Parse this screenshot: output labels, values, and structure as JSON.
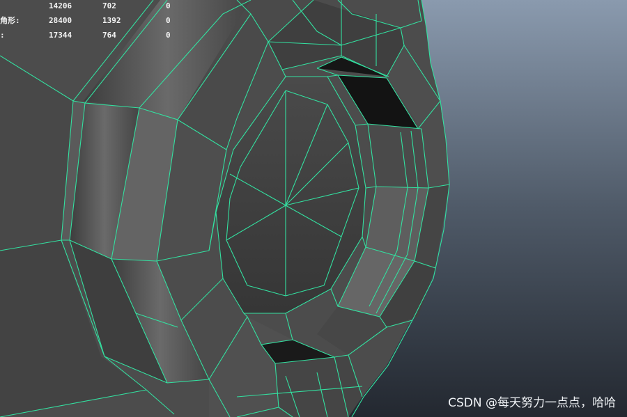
{
  "heads_up_display": {
    "rows": [
      {
        "label": "",
        "col1": "14206",
        "col2": "702",
        "col3": "0"
      },
      {
        "label": "角形:",
        "col1": "28400",
        "col2": "1392",
        "col3": "0"
      },
      {
        "label": ":",
        "col1": "17344",
        "col2": "764",
        "col3": "0"
      }
    ]
  },
  "watermark": {
    "text": "CSDN @每天努力一点点，哈哈"
  },
  "colors": {
    "wireframe": "#33e0a0",
    "background_top": "#8a9aae",
    "background_bottom": "#2a3039",
    "mesh_face": "#555555",
    "hole": "#141414"
  }
}
